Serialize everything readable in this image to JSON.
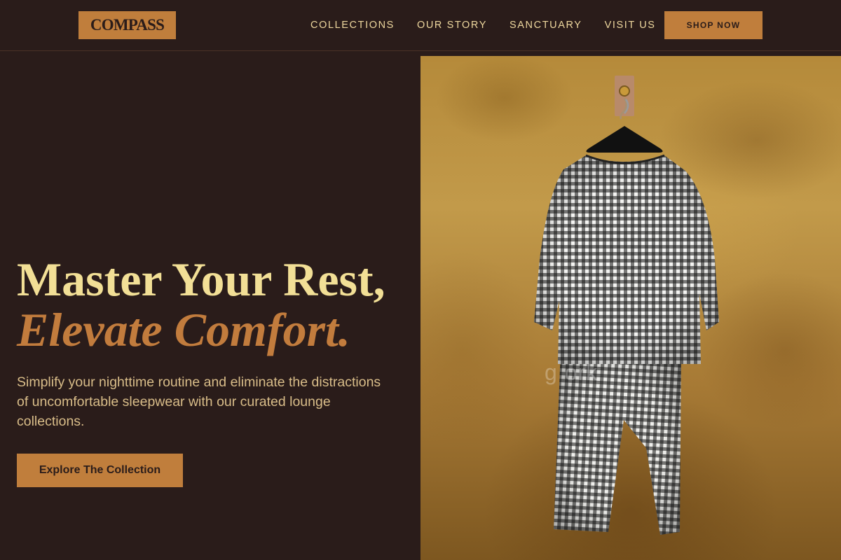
{
  "brand": {
    "name": "COMPASS"
  },
  "nav": {
    "links": [
      "COLLECTIONS",
      "OUR STORY",
      "SANCTUARY",
      "VISIT US"
    ],
    "cta_label": "SHOP NOW"
  },
  "hero": {
    "headline_line1": "Master Your Rest,",
    "headline_line2": "Elevate Comfort.",
    "subtext": "Simplify your nighttime routine and eliminate the distractions of uncomfortable sleepwear with our curated lounge collections.",
    "cta_label": "Explore The Collection"
  },
  "image": {
    "subject": "gingham-pajama-set-on-hanger",
    "watermark_text": "g        ork"
  },
  "colors": {
    "background": "#2a1c1a",
    "accent": "#c07e3c",
    "headline": "#f2df96",
    "body_text": "#d9bd89"
  }
}
